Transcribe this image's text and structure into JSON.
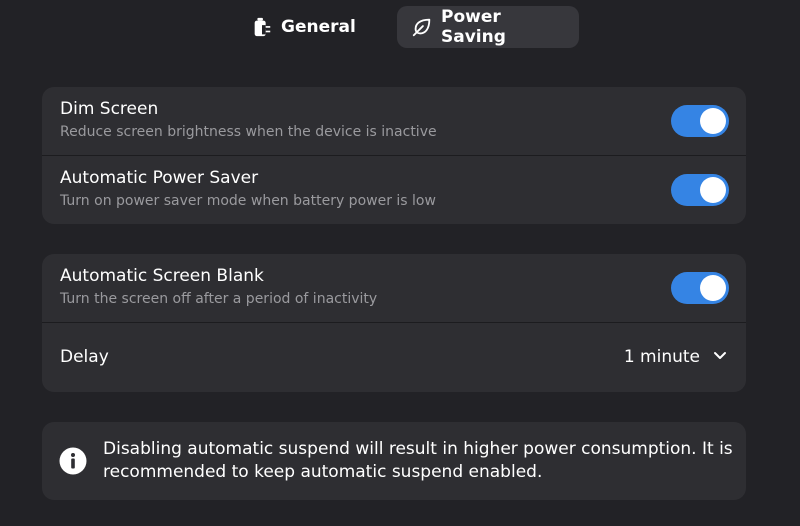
{
  "tabs": [
    {
      "label": "General",
      "icon": "battery-plug-icon",
      "selected": false
    },
    {
      "label": "Power Saving",
      "icon": "leaf-icon",
      "selected": true
    }
  ],
  "group1": {
    "rows": [
      {
        "title": "Dim Screen",
        "subtitle": "Reduce screen brightness when the device is inactive",
        "enabled": true
      },
      {
        "title": "Automatic Power Saver",
        "subtitle": "Turn on power saver mode when battery power is low",
        "enabled": true
      }
    ]
  },
  "group2": {
    "blank": {
      "title": "Automatic Screen Blank",
      "subtitle": "Turn the screen off after a period of inactivity",
      "enabled": true
    },
    "delay": {
      "title": "Delay",
      "value": "1 minute"
    }
  },
  "banner": {
    "icon": "info-icon",
    "text": "Disabling automatic suspend will result in higher power consumption. It is recommended to keep automatic suspend enabled."
  },
  "colors": {
    "background": "#222226",
    "card": "#2e2e32",
    "accent": "#3584e4",
    "subtitle": "#9a9a9e"
  }
}
